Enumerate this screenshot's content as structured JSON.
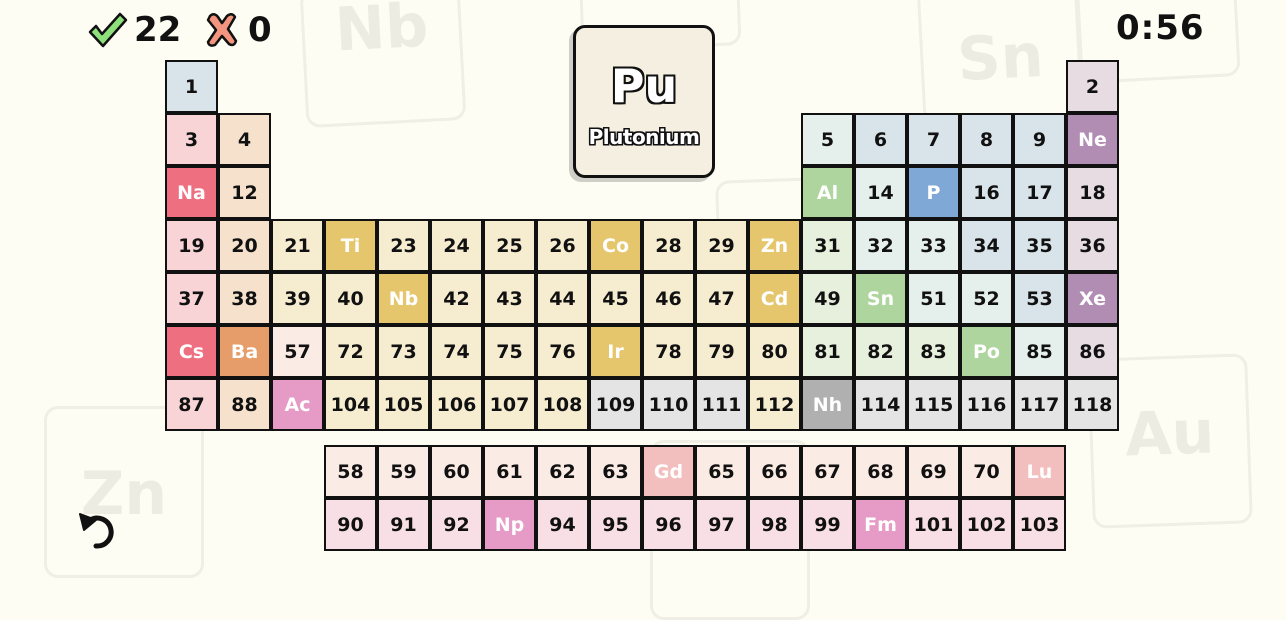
{
  "hud": {
    "correct_icon": "check-icon",
    "correct_count": "22",
    "wrong_icon": "cross-icon",
    "wrong_count": "0",
    "timer": "0:56"
  },
  "prompt_card": {
    "symbol": "Pu",
    "name": "Plutonium"
  },
  "controls": {
    "undo_icon": "undo-icon"
  },
  "background_tiles": [
    "Nb",
    "Sn",
    "Zn",
    "Au"
  ],
  "colors": {
    "background": "#fdfdf4",
    "check": "#8ee07a",
    "cross": "#f4957f",
    "alkali_light": "#f8d4d6",
    "alkali_solved": "#ee7080",
    "alkaline_light": "#f5e1cc",
    "alkaline_solved": "#e79d6a",
    "transition_light": "#f6ecd0",
    "transition_solved": "#e6c66c",
    "post_transition_light": "#e6f0dc",
    "post_transition_solved": "#afd59e",
    "metalloid_light": "#e5f0ec",
    "nonmetal_light": "#d8e3ea",
    "nonmetal_solved": "#80a8d6",
    "noble_light": "#e6dce2",
    "noble_solved": "#b28db3",
    "unknown_light": "#e4e4e4",
    "unknown_solved": "#b0b0b0",
    "lanthanide_light": "#fbebe5",
    "lanthanide_solved": "#f3bfbe",
    "actinide_light": "#f8dee5",
    "actinide_solved": "#e69bc6",
    "la_light": "#fbebe5",
    "hydrogen_light": "#d8e3ea"
  },
  "cells": [
    {
      "label": "1",
      "row": 1,
      "col": 1,
      "cat": "hydrogen",
      "solved": false
    },
    {
      "label": "2",
      "row": 1,
      "col": 18,
      "cat": "noble",
      "solved": false
    },
    {
      "label": "3",
      "row": 2,
      "col": 1,
      "cat": "alkali",
      "solved": false
    },
    {
      "label": "4",
      "row": 2,
      "col": 2,
      "cat": "alkaline",
      "solved": false
    },
    {
      "label": "5",
      "row": 2,
      "col": 13,
      "cat": "metalloid",
      "solved": false
    },
    {
      "label": "6",
      "row": 2,
      "col": 14,
      "cat": "nonmetal",
      "solved": false
    },
    {
      "label": "7",
      "row": 2,
      "col": 15,
      "cat": "nonmetal",
      "solved": false
    },
    {
      "label": "8",
      "row": 2,
      "col": 16,
      "cat": "nonmetal",
      "solved": false
    },
    {
      "label": "9",
      "row": 2,
      "col": 17,
      "cat": "nonmetal",
      "solved": false
    },
    {
      "label": "Ne",
      "row": 2,
      "col": 18,
      "cat": "noble",
      "solved": true
    },
    {
      "label": "Na",
      "row": 3,
      "col": 1,
      "cat": "alkali",
      "solved": true
    },
    {
      "label": "12",
      "row": 3,
      "col": 2,
      "cat": "alkaline",
      "solved": false
    },
    {
      "label": "Al",
      "row": 3,
      "col": 13,
      "cat": "post_transition",
      "solved": true
    },
    {
      "label": "14",
      "row": 3,
      "col": 14,
      "cat": "metalloid",
      "solved": false
    },
    {
      "label": "P",
      "row": 3,
      "col": 15,
      "cat": "nonmetal",
      "solved": true
    },
    {
      "label": "16",
      "row": 3,
      "col": 16,
      "cat": "nonmetal",
      "solved": false
    },
    {
      "label": "17",
      "row": 3,
      "col": 17,
      "cat": "nonmetal",
      "solved": false
    },
    {
      "label": "18",
      "row": 3,
      "col": 18,
      "cat": "noble",
      "solved": false
    },
    {
      "label": "19",
      "row": 4,
      "col": 1,
      "cat": "alkali",
      "solved": false
    },
    {
      "label": "20",
      "row": 4,
      "col": 2,
      "cat": "alkaline",
      "solved": false
    },
    {
      "label": "21",
      "row": 4,
      "col": 3,
      "cat": "transition",
      "solved": false
    },
    {
      "label": "Ti",
      "row": 4,
      "col": 4,
      "cat": "transition",
      "solved": true
    },
    {
      "label": "23",
      "row": 4,
      "col": 5,
      "cat": "transition",
      "solved": false
    },
    {
      "label": "24",
      "row": 4,
      "col": 6,
      "cat": "transition",
      "solved": false
    },
    {
      "label": "25",
      "row": 4,
      "col": 7,
      "cat": "transition",
      "solved": false
    },
    {
      "label": "26",
      "row": 4,
      "col": 8,
      "cat": "transition",
      "solved": false
    },
    {
      "label": "Co",
      "row": 4,
      "col": 9,
      "cat": "transition",
      "solved": true
    },
    {
      "label": "28",
      "row": 4,
      "col": 10,
      "cat": "transition",
      "solved": false
    },
    {
      "label": "29",
      "row": 4,
      "col": 11,
      "cat": "transition",
      "solved": false
    },
    {
      "label": "Zn",
      "row": 4,
      "col": 12,
      "cat": "transition",
      "solved": true
    },
    {
      "label": "31",
      "row": 4,
      "col": 13,
      "cat": "post_transition",
      "solved": false
    },
    {
      "label": "32",
      "row": 4,
      "col": 14,
      "cat": "metalloid",
      "solved": false
    },
    {
      "label": "33",
      "row": 4,
      "col": 15,
      "cat": "metalloid",
      "solved": false
    },
    {
      "label": "34",
      "row": 4,
      "col": 16,
      "cat": "nonmetal",
      "solved": false
    },
    {
      "label": "35",
      "row": 4,
      "col": 17,
      "cat": "nonmetal",
      "solved": false
    },
    {
      "label": "36",
      "row": 4,
      "col": 18,
      "cat": "noble",
      "solved": false
    },
    {
      "label": "37",
      "row": 5,
      "col": 1,
      "cat": "alkali",
      "solved": false
    },
    {
      "label": "38",
      "row": 5,
      "col": 2,
      "cat": "alkaline",
      "solved": false
    },
    {
      "label": "39",
      "row": 5,
      "col": 3,
      "cat": "transition",
      "solved": false
    },
    {
      "label": "40",
      "row": 5,
      "col": 4,
      "cat": "transition",
      "solved": false
    },
    {
      "label": "Nb",
      "row": 5,
      "col": 5,
      "cat": "transition",
      "solved": true
    },
    {
      "label": "42",
      "row": 5,
      "col": 6,
      "cat": "transition",
      "solved": false
    },
    {
      "label": "43",
      "row": 5,
      "col": 7,
      "cat": "transition",
      "solved": false
    },
    {
      "label": "44",
      "row": 5,
      "col": 8,
      "cat": "transition",
      "solved": false
    },
    {
      "label": "45",
      "row": 5,
      "col": 9,
      "cat": "transition",
      "solved": false
    },
    {
      "label": "46",
      "row": 5,
      "col": 10,
      "cat": "transition",
      "solved": false
    },
    {
      "label": "47",
      "row": 5,
      "col": 11,
      "cat": "transition",
      "solved": false
    },
    {
      "label": "Cd",
      "row": 5,
      "col": 12,
      "cat": "transition",
      "solved": true
    },
    {
      "label": "49",
      "row": 5,
      "col": 13,
      "cat": "post_transition",
      "solved": false
    },
    {
      "label": "Sn",
      "row": 5,
      "col": 14,
      "cat": "post_transition",
      "solved": true
    },
    {
      "label": "51",
      "row": 5,
      "col": 15,
      "cat": "metalloid",
      "solved": false
    },
    {
      "label": "52",
      "row": 5,
      "col": 16,
      "cat": "metalloid",
      "solved": false
    },
    {
      "label": "53",
      "row": 5,
      "col": 17,
      "cat": "nonmetal",
      "solved": false
    },
    {
      "label": "Xe",
      "row": 5,
      "col": 18,
      "cat": "noble",
      "solved": true
    },
    {
      "label": "Cs",
      "row": 6,
      "col": 1,
      "cat": "alkali",
      "solved": true
    },
    {
      "label": "Ba",
      "row": 6,
      "col": 2,
      "cat": "alkaline",
      "solved": true
    },
    {
      "label": "57",
      "row": 6,
      "col": 3,
      "cat": "la",
      "solved": false
    },
    {
      "label": "72",
      "row": 6,
      "col": 4,
      "cat": "transition",
      "solved": false
    },
    {
      "label": "73",
      "row": 6,
      "col": 5,
      "cat": "transition",
      "solved": false
    },
    {
      "label": "74",
      "row": 6,
      "col": 6,
      "cat": "transition",
      "solved": false
    },
    {
      "label": "75",
      "row": 6,
      "col": 7,
      "cat": "transition",
      "solved": false
    },
    {
      "label": "76",
      "row": 6,
      "col": 8,
      "cat": "transition",
      "solved": false
    },
    {
      "label": "Ir",
      "row": 6,
      "col": 9,
      "cat": "transition",
      "solved": true
    },
    {
      "label": "78",
      "row": 6,
      "col": 10,
      "cat": "transition",
      "solved": false
    },
    {
      "label": "79",
      "row": 6,
      "col": 11,
      "cat": "transition",
      "solved": false
    },
    {
      "label": "80",
      "row": 6,
      "col": 12,
      "cat": "transition",
      "solved": false
    },
    {
      "label": "81",
      "row": 6,
      "col": 13,
      "cat": "post_transition",
      "solved": false
    },
    {
      "label": "82",
      "row": 6,
      "col": 14,
      "cat": "post_transition",
      "solved": false
    },
    {
      "label": "83",
      "row": 6,
      "col": 15,
      "cat": "post_transition",
      "solved": false
    },
    {
      "label": "Po",
      "row": 6,
      "col": 16,
      "cat": "post_transition",
      "solved": true
    },
    {
      "label": "85",
      "row": 6,
      "col": 17,
      "cat": "metalloid",
      "solved": false
    },
    {
      "label": "86",
      "row": 6,
      "col": 18,
      "cat": "noble",
      "solved": false
    },
    {
      "label": "87",
      "row": 7,
      "col": 1,
      "cat": "alkali",
      "solved": false
    },
    {
      "label": "88",
      "row": 7,
      "col": 2,
      "cat": "alkaline",
      "solved": false
    },
    {
      "label": "Ac",
      "row": 7,
      "col": 3,
      "cat": "actinide",
      "solved": true
    },
    {
      "label": "104",
      "row": 7,
      "col": 4,
      "cat": "transition",
      "solved": false
    },
    {
      "label": "105",
      "row": 7,
      "col": 5,
      "cat": "transition",
      "solved": false
    },
    {
      "label": "106",
      "row": 7,
      "col": 6,
      "cat": "transition",
      "solved": false
    },
    {
      "label": "107",
      "row": 7,
      "col": 7,
      "cat": "transition",
      "solved": false
    },
    {
      "label": "108",
      "row": 7,
      "col": 8,
      "cat": "transition",
      "solved": false
    },
    {
      "label": "109",
      "row": 7,
      "col": 9,
      "cat": "unknown",
      "solved": false
    },
    {
      "label": "110",
      "row": 7,
      "col": 10,
      "cat": "unknown",
      "solved": false
    },
    {
      "label": "111",
      "row": 7,
      "col": 11,
      "cat": "unknown",
      "solved": false
    },
    {
      "label": "112",
      "row": 7,
      "col": 12,
      "cat": "transition",
      "solved": false
    },
    {
      "label": "Nh",
      "row": 7,
      "col": 13,
      "cat": "unknown",
      "solved": true
    },
    {
      "label": "114",
      "row": 7,
      "col": 14,
      "cat": "unknown",
      "solved": false
    },
    {
      "label": "115",
      "row": 7,
      "col": 15,
      "cat": "unknown",
      "solved": false
    },
    {
      "label": "116",
      "row": 7,
      "col": 16,
      "cat": "unknown",
      "solved": false
    },
    {
      "label": "117",
      "row": 7,
      "col": 17,
      "cat": "unknown",
      "solved": false
    },
    {
      "label": "118",
      "row": 7,
      "col": 18,
      "cat": "unknown",
      "solved": false
    },
    {
      "label": "58",
      "row": 8,
      "col": 4,
      "cat": "lanthanide",
      "solved": false
    },
    {
      "label": "59",
      "row": 8,
      "col": 5,
      "cat": "lanthanide",
      "solved": false
    },
    {
      "label": "60",
      "row": 8,
      "col": 6,
      "cat": "lanthanide",
      "solved": false
    },
    {
      "label": "61",
      "row": 8,
      "col": 7,
      "cat": "lanthanide",
      "solved": false
    },
    {
      "label": "62",
      "row": 8,
      "col": 8,
      "cat": "lanthanide",
      "solved": false
    },
    {
      "label": "63",
      "row": 8,
      "col": 9,
      "cat": "lanthanide",
      "solved": false
    },
    {
      "label": "Gd",
      "row": 8,
      "col": 10,
      "cat": "lanthanide",
      "solved": true
    },
    {
      "label": "65",
      "row": 8,
      "col": 11,
      "cat": "lanthanide",
      "solved": false
    },
    {
      "label": "66",
      "row": 8,
      "col": 12,
      "cat": "lanthanide",
      "solved": false
    },
    {
      "label": "67",
      "row": 8,
      "col": 13,
      "cat": "lanthanide",
      "solved": false
    },
    {
      "label": "68",
      "row": 8,
      "col": 14,
      "cat": "lanthanide",
      "solved": false
    },
    {
      "label": "69",
      "row": 8,
      "col": 15,
      "cat": "lanthanide",
      "solved": false
    },
    {
      "label": "70",
      "row": 8,
      "col": 16,
      "cat": "lanthanide",
      "solved": false
    },
    {
      "label": "Lu",
      "row": 8,
      "col": 17,
      "cat": "lanthanide",
      "solved": true
    },
    {
      "label": "90",
      "row": 9,
      "col": 4,
      "cat": "actinide",
      "solved": false
    },
    {
      "label": "91",
      "row": 9,
      "col": 5,
      "cat": "actinide",
      "solved": false
    },
    {
      "label": "92",
      "row": 9,
      "col": 6,
      "cat": "actinide",
      "solved": false
    },
    {
      "label": "Np",
      "row": 9,
      "col": 7,
      "cat": "actinide",
      "solved": true
    },
    {
      "label": "94",
      "row": 9,
      "col": 8,
      "cat": "actinide",
      "solved": false
    },
    {
      "label": "95",
      "row": 9,
      "col": 9,
      "cat": "actinide",
      "solved": false
    },
    {
      "label": "96",
      "row": 9,
      "col": 10,
      "cat": "actinide",
      "solved": false
    },
    {
      "label": "97",
      "row": 9,
      "col": 11,
      "cat": "actinide",
      "solved": false
    },
    {
      "label": "98",
      "row": 9,
      "col": 12,
      "cat": "actinide",
      "solved": false
    },
    {
      "label": "99",
      "row": 9,
      "col": 13,
      "cat": "actinide",
      "solved": false
    },
    {
      "label": "Fm",
      "row": 9,
      "col": 14,
      "cat": "actinide",
      "solved": true
    },
    {
      "label": "101",
      "row": 9,
      "col": 15,
      "cat": "actinide",
      "solved": false
    },
    {
      "label": "102",
      "row": 9,
      "col": 16,
      "cat": "actinide",
      "solved": false
    },
    {
      "label": "103",
      "row": 9,
      "col": 17,
      "cat": "actinide",
      "solved": false
    }
  ]
}
